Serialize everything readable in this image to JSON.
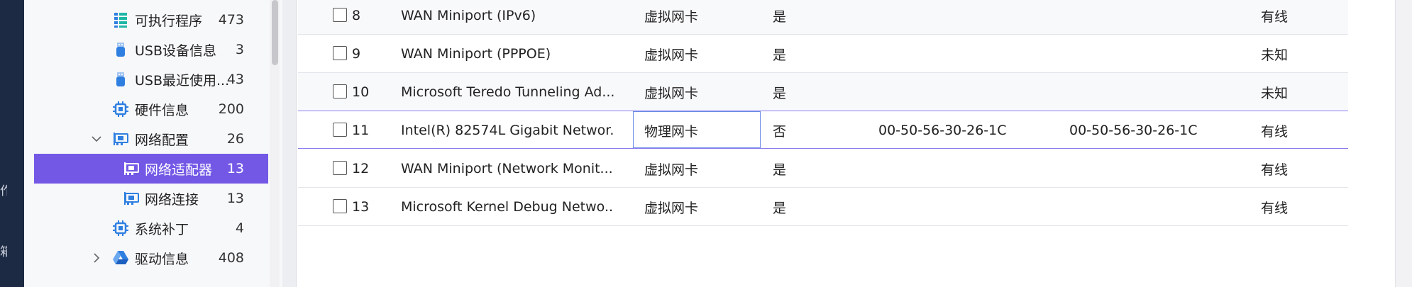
{
  "left_rail": {
    "glyph_1": "作",
    "glyph_2": "箱"
  },
  "tree": {
    "items": [
      {
        "label": "可执行程序",
        "count": "473",
        "icon": "list-icon"
      },
      {
        "label": "USB设备信息",
        "count": "3",
        "icon": "usb-icon"
      },
      {
        "label": "USB最近使用...",
        "count": "43",
        "icon": "usb-icon"
      },
      {
        "label": "硬件信息",
        "count": "200",
        "icon": "chip-icon"
      },
      {
        "label": "网络配置",
        "count": "26",
        "icon": "network-card-icon",
        "expanded": true
      },
      {
        "label": "网络适配器",
        "count": "13",
        "icon": "network-card-icon",
        "selected": true
      },
      {
        "label": "网络连接",
        "count": "13",
        "icon": "network-card-icon"
      },
      {
        "label": "系统补丁",
        "count": "4",
        "icon": "chip-icon"
      },
      {
        "label": "驱动信息",
        "count": "408",
        "icon": "drive-icon",
        "expanded": false
      }
    ]
  },
  "table": {
    "rows": [
      {
        "no": "8",
        "name": "WAN Miniport (IPv6)",
        "type": "虚拟网卡",
        "virtual": "是",
        "mac1": "",
        "mac2": "",
        "connection": "有线"
      },
      {
        "no": "9",
        "name": "WAN Miniport (PPPOE)",
        "type": "虚拟网卡",
        "virtual": "是",
        "mac1": "",
        "mac2": "",
        "connection": "未知"
      },
      {
        "no": "10",
        "name": "Microsoft Teredo Tunneling Ad...",
        "type": "虚拟网卡",
        "virtual": "是",
        "mac1": "",
        "mac2": "",
        "connection": "未知"
      },
      {
        "no": "11",
        "name": "Intel(R) 82574L Gigabit Networ...",
        "type": "物理网卡",
        "virtual": "否",
        "mac1": "00-50-56-30-26-1C",
        "mac2": "00-50-56-30-26-1C",
        "connection": "有线",
        "editing": true
      },
      {
        "no": "12",
        "name": "WAN Miniport (Network Monit...",
        "type": "虚拟网卡",
        "virtual": "是",
        "mac1": "",
        "mac2": "",
        "connection": "有线"
      },
      {
        "no": "13",
        "name": "Microsoft Kernel Debug Netwo...",
        "type": "虚拟网卡",
        "virtual": "是",
        "mac1": "",
        "mac2": "",
        "connection": "有线"
      }
    ]
  },
  "colors": {
    "selected_bg": "#7358e6",
    "icon_blue": "#2f7fe0",
    "icon_teal": "#1fb6a6",
    "rail": "#1d2a44",
    "highlight_border": "#8a7df0"
  }
}
